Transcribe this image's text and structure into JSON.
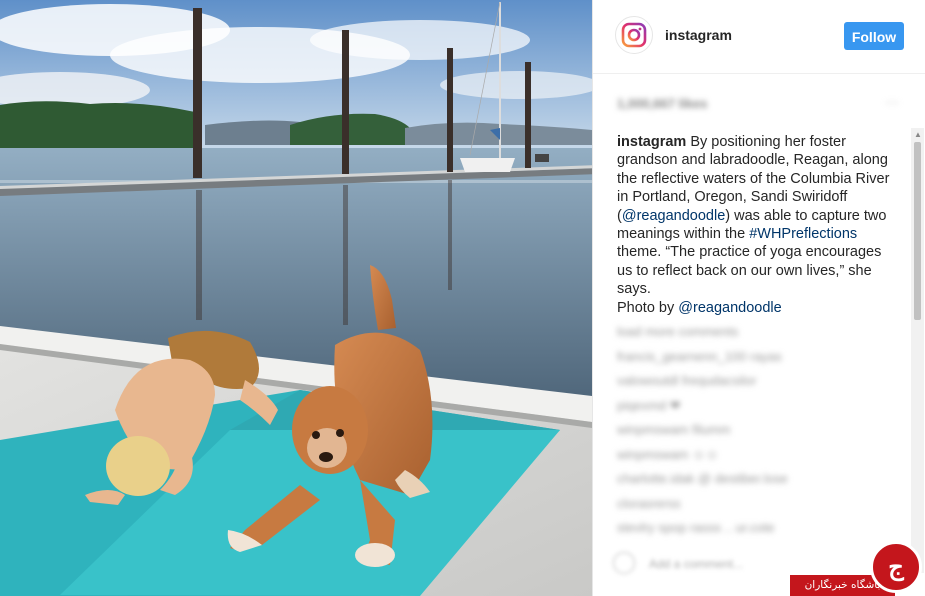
{
  "header": {
    "username": "instagram",
    "follow_label": "Follow"
  },
  "likes": {
    "text": "1,000,667 likes"
  },
  "caption": {
    "user": "instagram",
    "text1": " By positioning her foster grandson and labradoodle, Reagan, along the reflective waters of the Columbia River in Portland, Oregon, Sandi Swiridoff (",
    "mention1": "@reagandoodle",
    "text2": ") was able to capture two meanings within the ",
    "hashtag": "#WHPreflections",
    "text3": " theme. “The practice of yoga encourages us to reflect back on our own lives,” she says.",
    "photo_by": "Photo by ",
    "mention2": "@reagandoodle"
  },
  "comments": [
    "load more comments",
    "francis_gearnenn_100 rayas",
    "valowoutdl frequdacsilor",
    "piqexmd ❤",
    "winpmswam filumm",
    "winpmswam ☺☺",
    "charlotte.idak @ destiber.lose",
    "clorasrerss",
    "stevlry spop rasss .. ur.cote"
  ],
  "comment_box": {
    "placeholder": "Add a comment..."
  },
  "watermark": {
    "text": "باشگاه خبرنگاران",
    "logo_glyph": "ج"
  },
  "icons": {
    "instagram_logo": "instagram-logo-icon",
    "heart": "heart-icon",
    "more": "more-icon"
  },
  "colors": {
    "follow_bg": "#3897f0",
    "link": "#003569",
    "watermark": "#c4161c"
  }
}
